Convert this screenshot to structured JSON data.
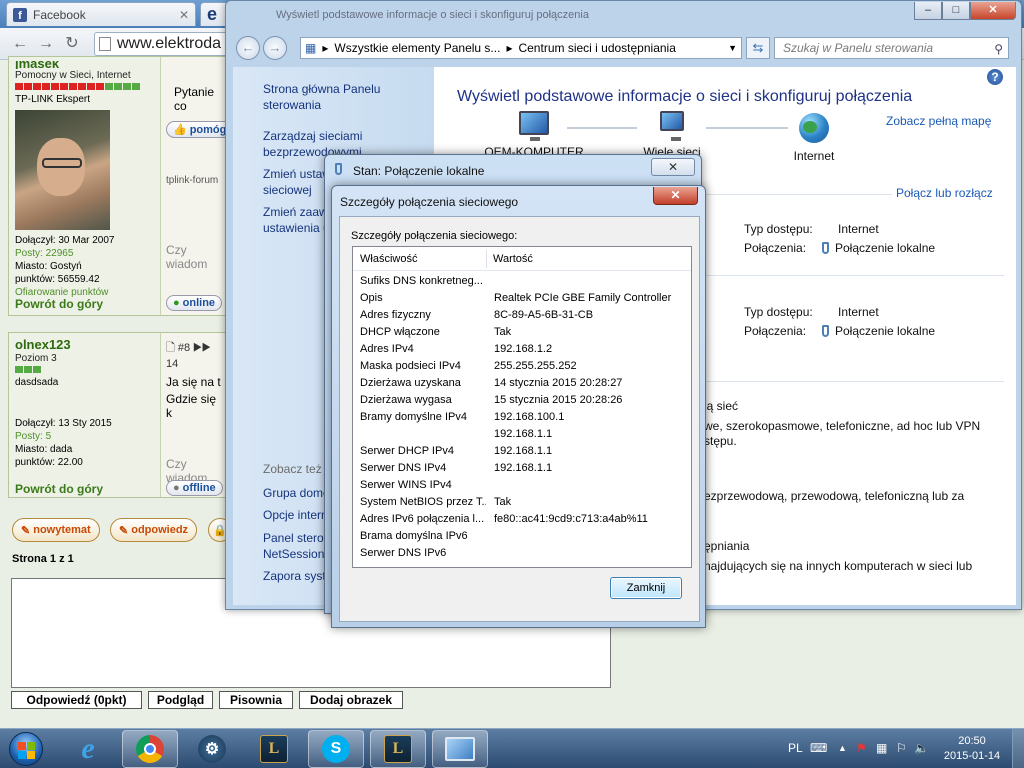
{
  "browser": {
    "tab_title": "Facebook",
    "tab2_letter": "e",
    "url": "www.elektroda",
    "fb_letter": "f"
  },
  "forum": {
    "post1": {
      "username": "jmasek",
      "rank": "Pomocny w Sieci, Internet",
      "title": "TP-LINK Ekspert",
      "joined": "Dołączył: 30 Mar 2007",
      "posts": "Posty: 22965",
      "city": "Miasto: Gostyń",
      "points": "punktów: 56559.42",
      "points_given": "Ofiarowanie punktów",
      "body": "Pytanie co",
      "help_btn": "pomóg",
      "signature": "tplink-forum",
      "hint": "Czy wiadom",
      "back_top": "Powrót do góry",
      "status": "online"
    },
    "post2": {
      "username": "olnex123",
      "rank": "Poziom 3",
      "title": "dasdsada",
      "joined": "Dołączył: 13 Sty 2015",
      "posts": "Posty: 5",
      "city": "Miasto: dada",
      "points": "punktów: 22.00",
      "post_ref": "#8",
      "post_ref_tail": "14",
      "body_line1": "Ja się na t",
      "body_line2": "Gdzie się k",
      "hint": "Czy wiadom",
      "back_top": "Powrót do góry",
      "status": "offline"
    },
    "new_topic": "nowytemat",
    "reply": "odpowiedz",
    "page_info": "Strona 1 z 1",
    "buttons": [
      "Odpowiedź (0pkt)",
      "Podgląd",
      "Pisownia",
      "Dodaj obrazek"
    ]
  },
  "control_panel": {
    "window_title": "Wyświetl podstawowe informacje o sieci i skonfiguruj połączenia",
    "breadcrumb": [
      "Wszystkie elementy Panelu s...",
      "Centrum sieci i udostępniania"
    ],
    "search_placeholder": "Szukaj w Panelu sterowania",
    "nav": {
      "home": "Strona główna Panelu sterowania",
      "manage_wireless": "Zarządzaj sieciami bezprzewodowymi",
      "change_adapter": "Zmień ustawienia karty sieciowej",
      "change_advanced": "Zmień zaawansowane ustawienia udostępniania",
      "see_also": "Zobacz też",
      "homegroup": "Grupa domowa",
      "internet_options": "Opcje internetowe",
      "akamai": "Panel sterowania Akamai NetSession",
      "firewall": "Zapora systemu Windows"
    },
    "heading": "Wyświetl podstawowe informacje o sieci i skonfiguruj połączenia",
    "see_full_map": "Zobacz pełną mapę",
    "map": {
      "computer": "OEM-KOMPUTER",
      "network": "Wiele sieci",
      "internet": "Internet"
    },
    "connect_disconnect": "Połącz lub rozłącz",
    "networks": [
      {
        "access_label": "Typ dostępu:",
        "access_value": "Internet",
        "conn_label": "Połączenia:",
        "conn_value": "Połączenie lokalne"
      },
      {
        "access_label": "Typ dostępu:",
        "access_value": "Internet",
        "conn_label": "Połączenia:",
        "conn_value": "Połączenie lokalne"
      }
    ],
    "tasks": {
      "setup_link": "ją sieć",
      "setup_desc1": "we, szerokopasmowe, telefoniczne, ad hoc lub VPN",
      "setup_desc2": "stępu.",
      "connect_desc": "ezprzewodową, przewodową, telefoniczną lub za",
      "sharing_link": "ępniania",
      "sharing_desc": "najdujących się na innych komputerach w sieci lub"
    }
  },
  "status_dialog": {
    "title": "Stan: Połączenie lokalne",
    "close": "✕"
  },
  "details_dialog": {
    "title": "Szczegóły połączenia sieciowego",
    "caption": "Szczegóły połączenia sieciowego:",
    "col_property": "Właściwość",
    "col_value": "Wartość",
    "rows": [
      {
        "p": "Sufiks DNS konkretneg...",
        "v": ""
      },
      {
        "p": "Opis",
        "v": "Realtek PCIe GBE Family Controller"
      },
      {
        "p": "Adres fizyczny",
        "v": "8C-89-A5-6B-31-CB"
      },
      {
        "p": "DHCP włączone",
        "v": "Tak"
      },
      {
        "p": "Adres IPv4",
        "v": "192.168.1.2"
      },
      {
        "p": "Maska podsieci IPv4",
        "v": "255.255.255.252"
      },
      {
        "p": "Dzierżawa uzyskana",
        "v": "14 stycznia 2015 20:28:27"
      },
      {
        "p": "Dzierżawa wygasa",
        "v": "15 stycznia 2015 20:28:26"
      },
      {
        "p": "Bramy domyślne IPv4",
        "v": "192.168.100.1"
      },
      {
        "p": "",
        "v": "192.168.1.1"
      },
      {
        "p": "Serwer DHCP IPv4",
        "v": "192.168.1.1"
      },
      {
        "p": "Serwer DNS IPv4",
        "v": "192.168.1.1"
      },
      {
        "p": "Serwer WINS IPv4",
        "v": ""
      },
      {
        "p": "System NetBIOS przez T...",
        "v": "Tak"
      },
      {
        "p": "Adres IPv6 połączenia l...",
        "v": "fe80::ac41:9cd9:c713:a4ab%11"
      },
      {
        "p": "Brama domyślna IPv6",
        "v": ""
      },
      {
        "p": "Serwer DNS IPv6",
        "v": ""
      }
    ],
    "close_button": "Zamknij"
  },
  "taskbar": {
    "apps": [
      "start-icon",
      "internet-explorer-icon",
      "chrome-icon",
      "steam-icon",
      "league-of-legends-icon",
      "skype-icon",
      "league-of-legends-icon",
      "network-center-icon"
    ],
    "language": "PL",
    "time": "20:50",
    "date": "2015-01-14"
  }
}
